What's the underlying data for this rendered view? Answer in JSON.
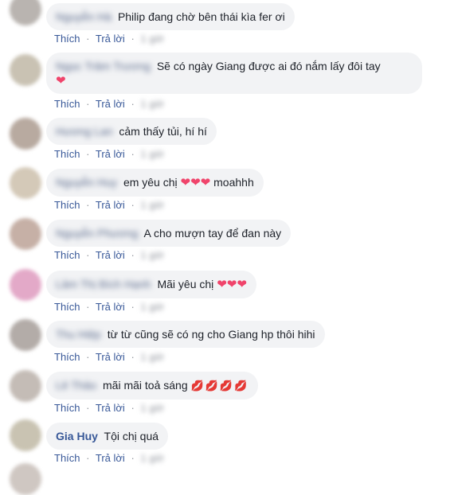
{
  "comments": [
    {
      "name": "Nguyễn Hà",
      "text": "Philip đang chờ bên thái kìa fer ơi",
      "emoji": "",
      "time": "1 giờ"
    },
    {
      "name": "Ngọc Trâm Trương",
      "text": "Sẽ có ngày Giang được ai đó nắm lấy đôi tay",
      "emoji": "❤",
      "time": "1 giờ"
    },
    {
      "name": "Hương Lan",
      "text": "cảm thấy tủi, hí hí",
      "emoji": "",
      "time": "1 giờ"
    },
    {
      "name": "Nguyễn Huy",
      "text": "em yêu chị",
      "emoji": "❤❤❤",
      "text2": "moahhh",
      "time": "1 giờ"
    },
    {
      "name": "Nguyễn Phương",
      "text": "A cho mượn tay để đan này",
      "emoji": "",
      "time": "1 giờ"
    },
    {
      "name": "Lâm Thị Bích Hạnh",
      "text": "Mãi yêu chị",
      "emoji": "❤❤❤",
      "time": "1 giờ"
    },
    {
      "name": "Thu Hiệp",
      "text": "từ từ cũng sẽ có ng cho Giang hp thôi hihi",
      "emoji": "",
      "time": "1 giờ"
    },
    {
      "name": "Lê Thảo",
      "text": "mãi mãi toả sáng",
      "emoji": "💋💋💋💋",
      "time": "1 giờ"
    },
    {
      "name": "Gia Huy",
      "text": "Tội chị quá",
      "emoji": "",
      "time": "1 giờ"
    }
  ],
  "actions": {
    "like": "Thích",
    "reply": "Trả lời",
    "separator": "·"
  },
  "colors": {
    "link": "#385898",
    "bubble": "#f2f3f5",
    "heart": "#f0446b"
  }
}
